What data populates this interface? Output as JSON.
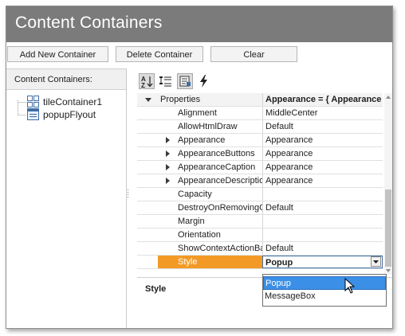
{
  "window": {
    "title": "Content Containers"
  },
  "toolbar": {
    "add_label": "Add New Container",
    "delete_label": "Delete Container",
    "clear_label": "Clear"
  },
  "tree": {
    "header": "Content Containers:",
    "items": [
      {
        "label": "tileContainer1",
        "icon": "tile-container-icon"
      },
      {
        "label": "popupFlyout",
        "icon": "flyout-icon"
      }
    ]
  },
  "property_grid": {
    "toolbar_icons": [
      "sort-alphabetical-icon",
      "categorized-icon",
      "properties-icon",
      "events-icon"
    ],
    "header": {
      "name": "Properties",
      "value": "Appearance = { Appearance"
    },
    "rows": [
      {
        "name": "Alignment",
        "value": "MiddleCenter",
        "expandable": false
      },
      {
        "name": "AllowHtmlDraw",
        "value": "Default",
        "expandable": false
      },
      {
        "name": "Appearance",
        "value": "Appearance",
        "expandable": true
      },
      {
        "name": "AppearanceButtons",
        "value": "Appearance",
        "expandable": true
      },
      {
        "name": "AppearanceCaption",
        "value": "Appearance",
        "expandable": true
      },
      {
        "name": "AppearanceDescription",
        "value": "Appearance",
        "expandable": true
      },
      {
        "name": "Capacity",
        "value": "",
        "expandable": false
      },
      {
        "name": "DestroyOnRemovingChildren",
        "value": "Default",
        "expandable": false
      },
      {
        "name": "Margin",
        "value": "",
        "expandable": false
      },
      {
        "name": "Orientation",
        "value": "",
        "expandable": false
      },
      {
        "name": "ShowContextActionBar",
        "value": "Default",
        "expandable": false
      },
      {
        "name": "Style",
        "value": "Popup",
        "expandable": false,
        "selected": true
      }
    ],
    "description_title": "Style",
    "dropdown_options": [
      "Popup",
      "MessageBox"
    ],
    "dropdown_highlighted": "Popup"
  },
  "colors": {
    "title_bar": "#7b7b7b",
    "selected_row": "#f39a26",
    "dropdown_highlight": "#3b8fe6",
    "icon_blue": "#3f6ea5"
  }
}
